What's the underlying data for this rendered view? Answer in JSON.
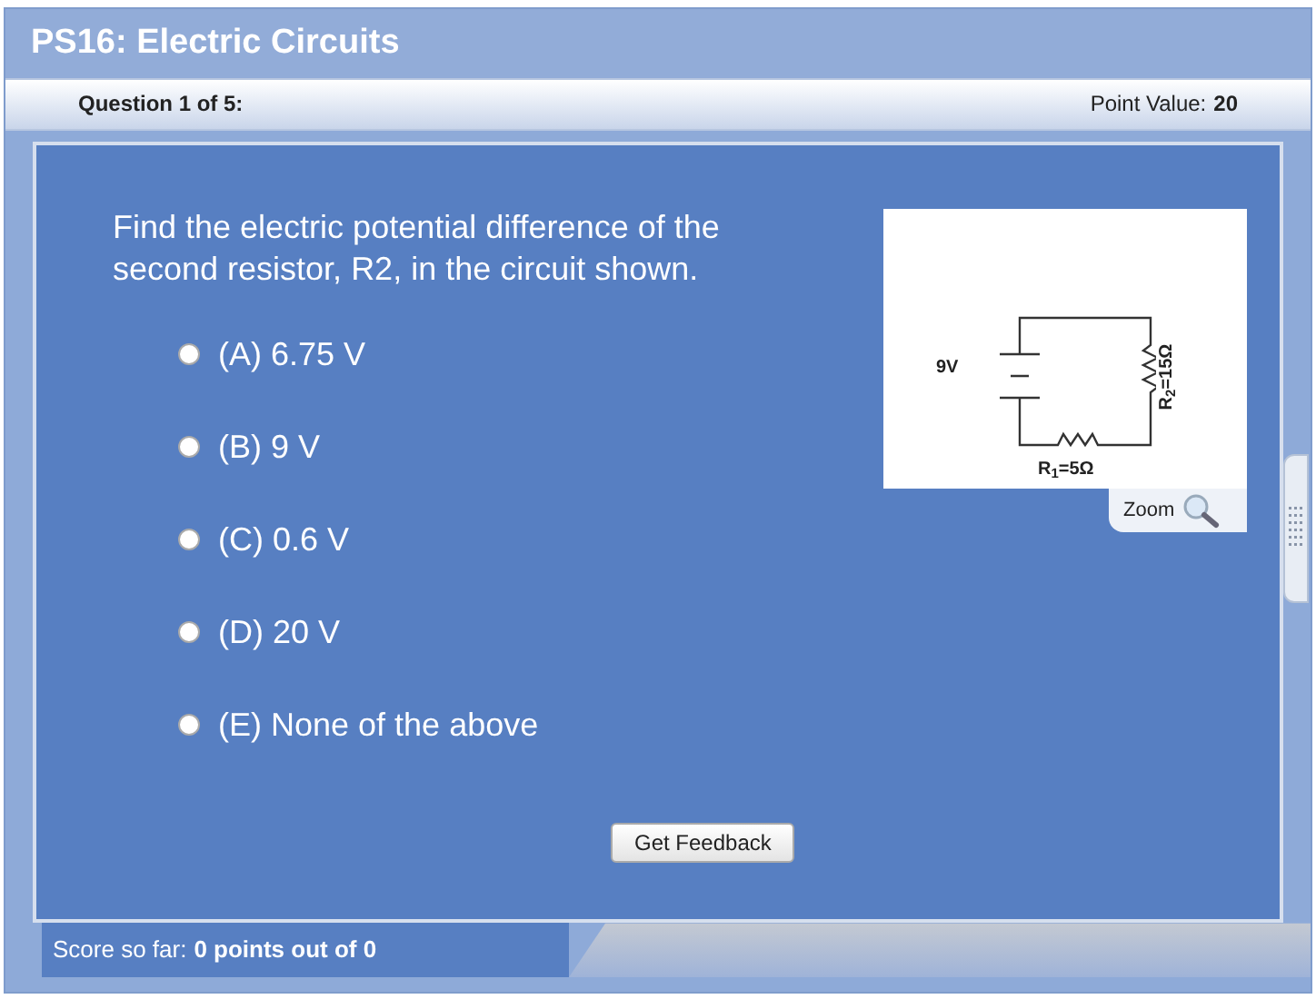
{
  "title": "PS16: Electric Circuits",
  "question_bar": {
    "progress": "Question 1 of 5:",
    "point_value_label": "Point Value:",
    "point_value": "20"
  },
  "question": {
    "text": "Find the electric potential difference of the second resistor, R2, in the circuit shown.",
    "options": [
      {
        "label": "(A) 6.75 V",
        "selected": false
      },
      {
        "label": "(B) 9 V",
        "selected": false
      },
      {
        "label": "(C) 0.6 V",
        "selected": false
      },
      {
        "label": "(D) 20 V",
        "selected": false
      },
      {
        "label": "(E) None of the above",
        "selected": false
      }
    ]
  },
  "diagram": {
    "battery": "9V",
    "r1": "R$_{1}$=5Ω",
    "r2": "R$_{2}$=15Ω",
    "zoom": "Zoom"
  },
  "feedback_button": "Get Feedback",
  "score": {
    "label": "Score so far:",
    "value": "0 points out of 0"
  }
}
